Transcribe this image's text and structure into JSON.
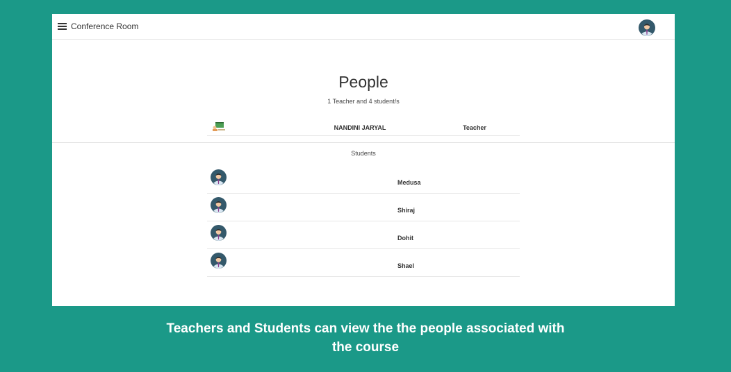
{
  "app": {
    "title": "Conference Room"
  },
  "page": {
    "heading": "People",
    "summary": "1 Teacher and 4 student/s"
  },
  "teacher": {
    "name": "NANDINI JARYAL",
    "role": "Teacher"
  },
  "students": {
    "label": "Students",
    "items": [
      {
        "name": "Medusa"
      },
      {
        "name": "Shiraj"
      },
      {
        "name": "Dohit"
      },
      {
        "name": "Shael"
      }
    ]
  },
  "caption": {
    "line1": "Teachers and Students can view the the people associated with",
    "line2": "the course"
  },
  "colors": {
    "background": "#1b9988",
    "surface": "#ffffff",
    "avatar_bg": "#34596b"
  },
  "icons": {
    "menu": "menu-icon",
    "avatar": "user-avatar-icon",
    "teacher": "teacher-board-icon"
  }
}
